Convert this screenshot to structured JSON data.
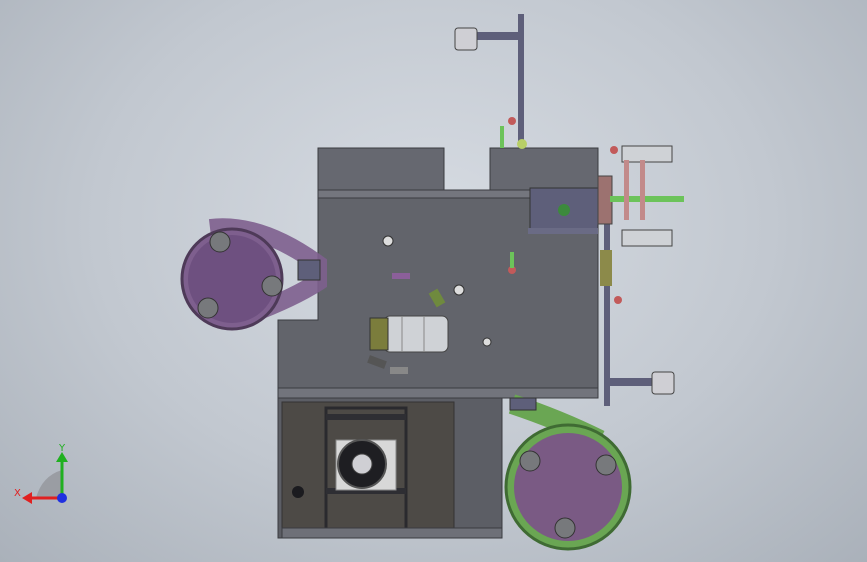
{
  "view": {
    "title": "",
    "orientation": "front"
  },
  "triad": {
    "x_label": "X",
    "y_label": "Y",
    "x_color": "#e02020",
    "y_color": "#20b020",
    "z_color": "#2030e0"
  },
  "colors": {
    "plate": "#62646b",
    "plate_dark": "#4e5057",
    "rail": "#5e5f7a",
    "reel_purple": "#7e5f8e",
    "reel_green": "#6aa653",
    "accent_red": "#c25a5a",
    "accent_green": "#6cc35a"
  }
}
